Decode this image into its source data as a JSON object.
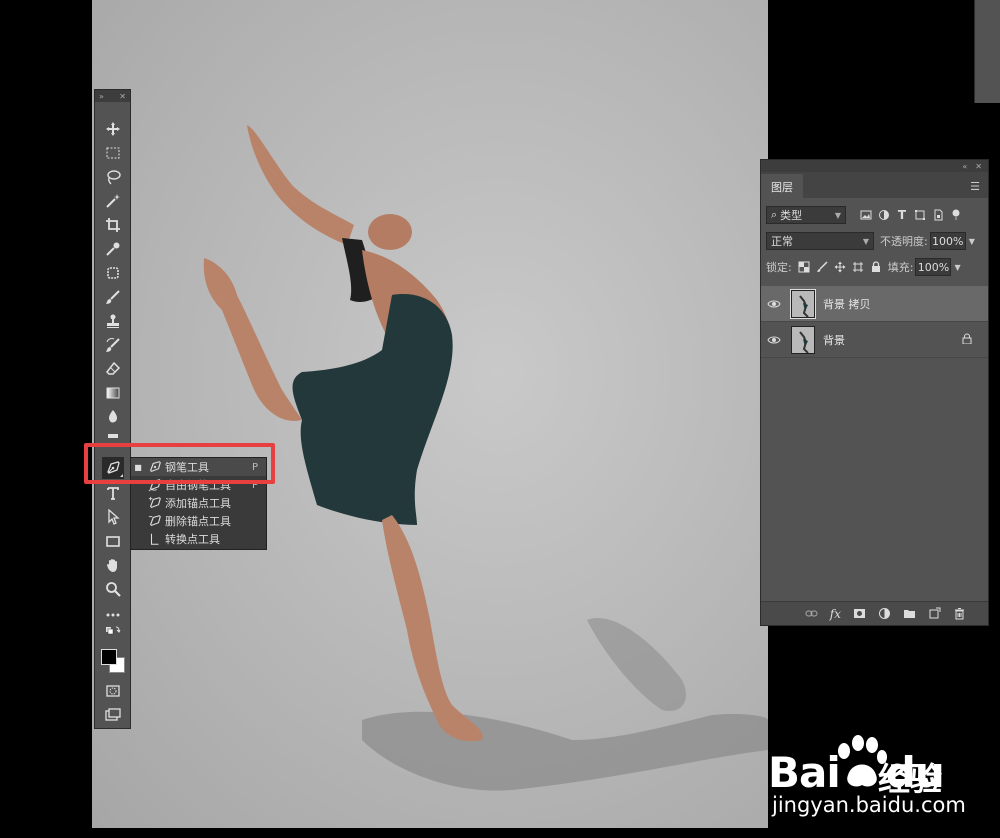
{
  "tool_flyout": {
    "items": [
      {
        "label": "钢笔工具",
        "shortcut": "P",
        "selected": true,
        "icon": "pen-icon"
      },
      {
        "label": "自由钢笔工具",
        "shortcut": "P",
        "selected": false,
        "icon": "freeform-pen-icon"
      },
      {
        "label": "添加锚点工具",
        "shortcut": "",
        "selected": false,
        "icon": "add-anchor-icon"
      },
      {
        "label": "删除锚点工具",
        "shortcut": "",
        "selected": false,
        "icon": "delete-anchor-icon"
      },
      {
        "label": "转换点工具",
        "shortcut": "",
        "selected": false,
        "icon": "convert-point-icon"
      }
    ]
  },
  "layers_panel": {
    "tab": "图层",
    "filter": {
      "label": "类型"
    },
    "blend_mode": "正常",
    "opacity": {
      "label": "不透明度:",
      "value": "100%"
    },
    "lock_label": "锁定:",
    "fill": {
      "label": "填充:",
      "value": "100%"
    },
    "layers": [
      {
        "name": "背景 拷贝",
        "active": true,
        "locked": false
      },
      {
        "name": "背景",
        "active": false,
        "locked": true
      }
    ]
  },
  "watermark": {
    "brand_latin": "Bai",
    "brand_suffix": "du",
    "brand_cn": "经验",
    "url": "jingyan.baidu.com"
  },
  "colors": {
    "highlight": "#e84040",
    "panel_bg": "#535353",
    "dress": "#23383a"
  }
}
